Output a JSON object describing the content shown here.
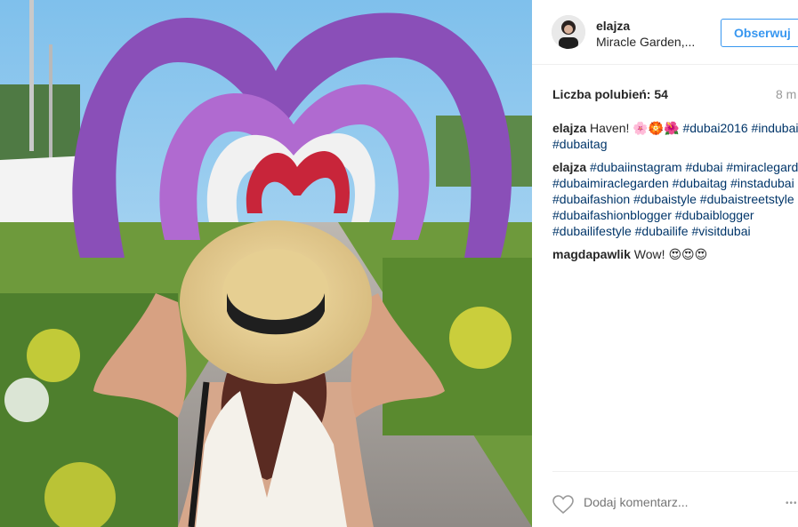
{
  "post": {
    "username": "elajza",
    "location": "Miracle Garden,...",
    "follow_label": "Obserwuj",
    "likes": "Liczba polubień: 54",
    "time": "8 m"
  },
  "comments": [
    {
      "user": "elajza",
      "parts": [
        {
          "type": "text",
          "text": " Haven! "
        },
        {
          "type": "text",
          "text": "🌸🏵️🌺"
        },
        {
          "type": "text",
          "text": " "
        },
        {
          "type": "tag",
          "text": "#dubai2016"
        },
        {
          "type": "text",
          "text": " "
        },
        {
          "type": "tag",
          "text": "#indubai"
        },
        {
          "type": "text",
          "text": " "
        },
        {
          "type": "tag",
          "text": "#dubaitag"
        }
      ]
    },
    {
      "user": "elajza",
      "parts": [
        {
          "type": "text",
          "text": " "
        },
        {
          "type": "tag",
          "text": "#dubaiinstagram"
        },
        {
          "type": "text",
          "text": " "
        },
        {
          "type": "tag",
          "text": "#dubai"
        },
        {
          "type": "text",
          "text": " "
        },
        {
          "type": "tag",
          "text": "#miraclegarden"
        },
        {
          "type": "text",
          "text": " "
        },
        {
          "type": "tag",
          "text": "#dubaimiraclegarden"
        },
        {
          "type": "text",
          "text": " "
        },
        {
          "type": "tag",
          "text": "#dubaitag"
        },
        {
          "type": "text",
          "text": " "
        },
        {
          "type": "tag",
          "text": "#instadubai"
        },
        {
          "type": "text",
          "text": " "
        },
        {
          "type": "tag",
          "text": "#dubaifashion"
        },
        {
          "type": "text",
          "text": " "
        },
        {
          "type": "tag",
          "text": "#dubaistyle"
        },
        {
          "type": "text",
          "text": " "
        },
        {
          "type": "tag",
          "text": "#dubaistreetstyle"
        },
        {
          "type": "text",
          "text": " "
        },
        {
          "type": "tag",
          "text": "#dubaifashionblogger"
        },
        {
          "type": "text",
          "text": " "
        },
        {
          "type": "tag",
          "text": "#dubaiblogger"
        },
        {
          "type": "text",
          "text": " "
        },
        {
          "type": "tag",
          "text": "#dubailifestyle"
        },
        {
          "type": "text",
          "text": " "
        },
        {
          "type": "tag",
          "text": "#dubailife"
        },
        {
          "type": "text",
          "text": " "
        },
        {
          "type": "tag",
          "text": "#visitdubai"
        }
      ]
    },
    {
      "user": "magdapawlik",
      "parts": [
        {
          "type": "text",
          "text": " Wow! "
        },
        {
          "type": "text",
          "text": "😍😍😍"
        }
      ]
    }
  ],
  "footer": {
    "comment_placeholder": "Dodaj komentarz...",
    "more_label": "•••"
  },
  "icons": {
    "like": "heart-icon",
    "more": "more-options-icon"
  },
  "colors": {
    "follow": "#3897f0",
    "hashtag": "#003569",
    "muted": "#999999"
  }
}
